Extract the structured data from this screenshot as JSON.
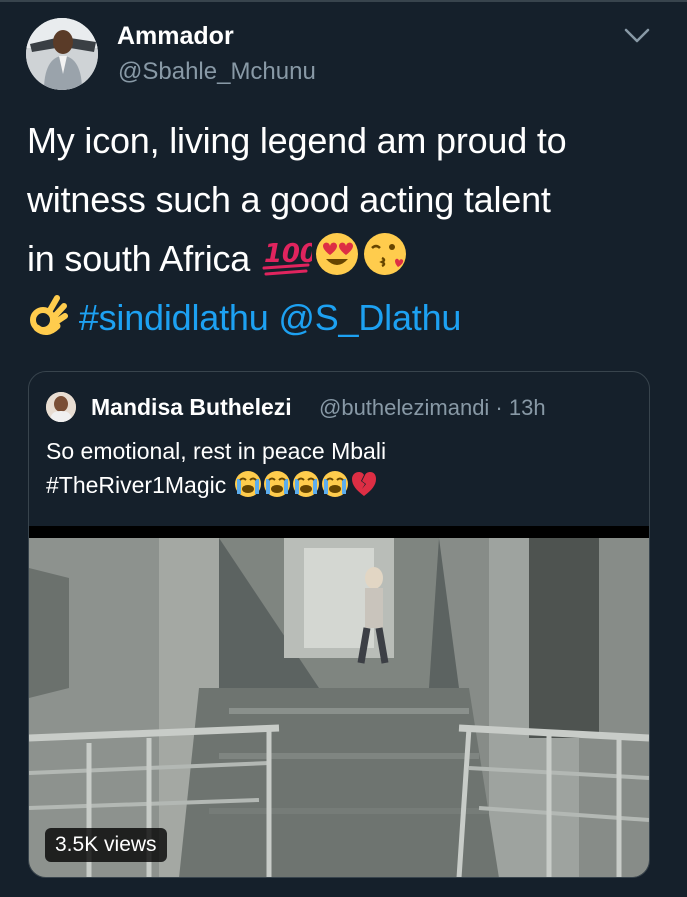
{
  "tweet": {
    "author_name": "Ammador",
    "author_handle": "@Sbahle_Mchunu",
    "text_lines": [
      "My icon, living legend am proud to",
      "witness such a good acting talent",
      "in south Africa"
    ],
    "emojis_line3": [
      "hundred-points-icon",
      "heart-eyes-icon",
      "kissing-face-icon"
    ],
    "emoji_line4": "ok-hand-icon",
    "hashtag": "#sindidlathu",
    "mention": "@S_Dlathu"
  },
  "quoted_tweet": {
    "author_name": "Mandisa Buthelezi",
    "author_handle": "@buthelezimandi · 13h",
    "text_line1": "So emotional, rest in peace Mbali",
    "text_line2": "#TheRiver1Magic",
    "emojis": [
      "crying-face-icon",
      "crying-face-icon",
      "crying-face-icon",
      "crying-face-icon",
      "broken-heart-icon"
    ],
    "views": "3.5K views"
  },
  "colors": {
    "background": "#15202b",
    "link": "#1da1f2",
    "secondary_text": "#8899a6",
    "border": "#38444d"
  }
}
